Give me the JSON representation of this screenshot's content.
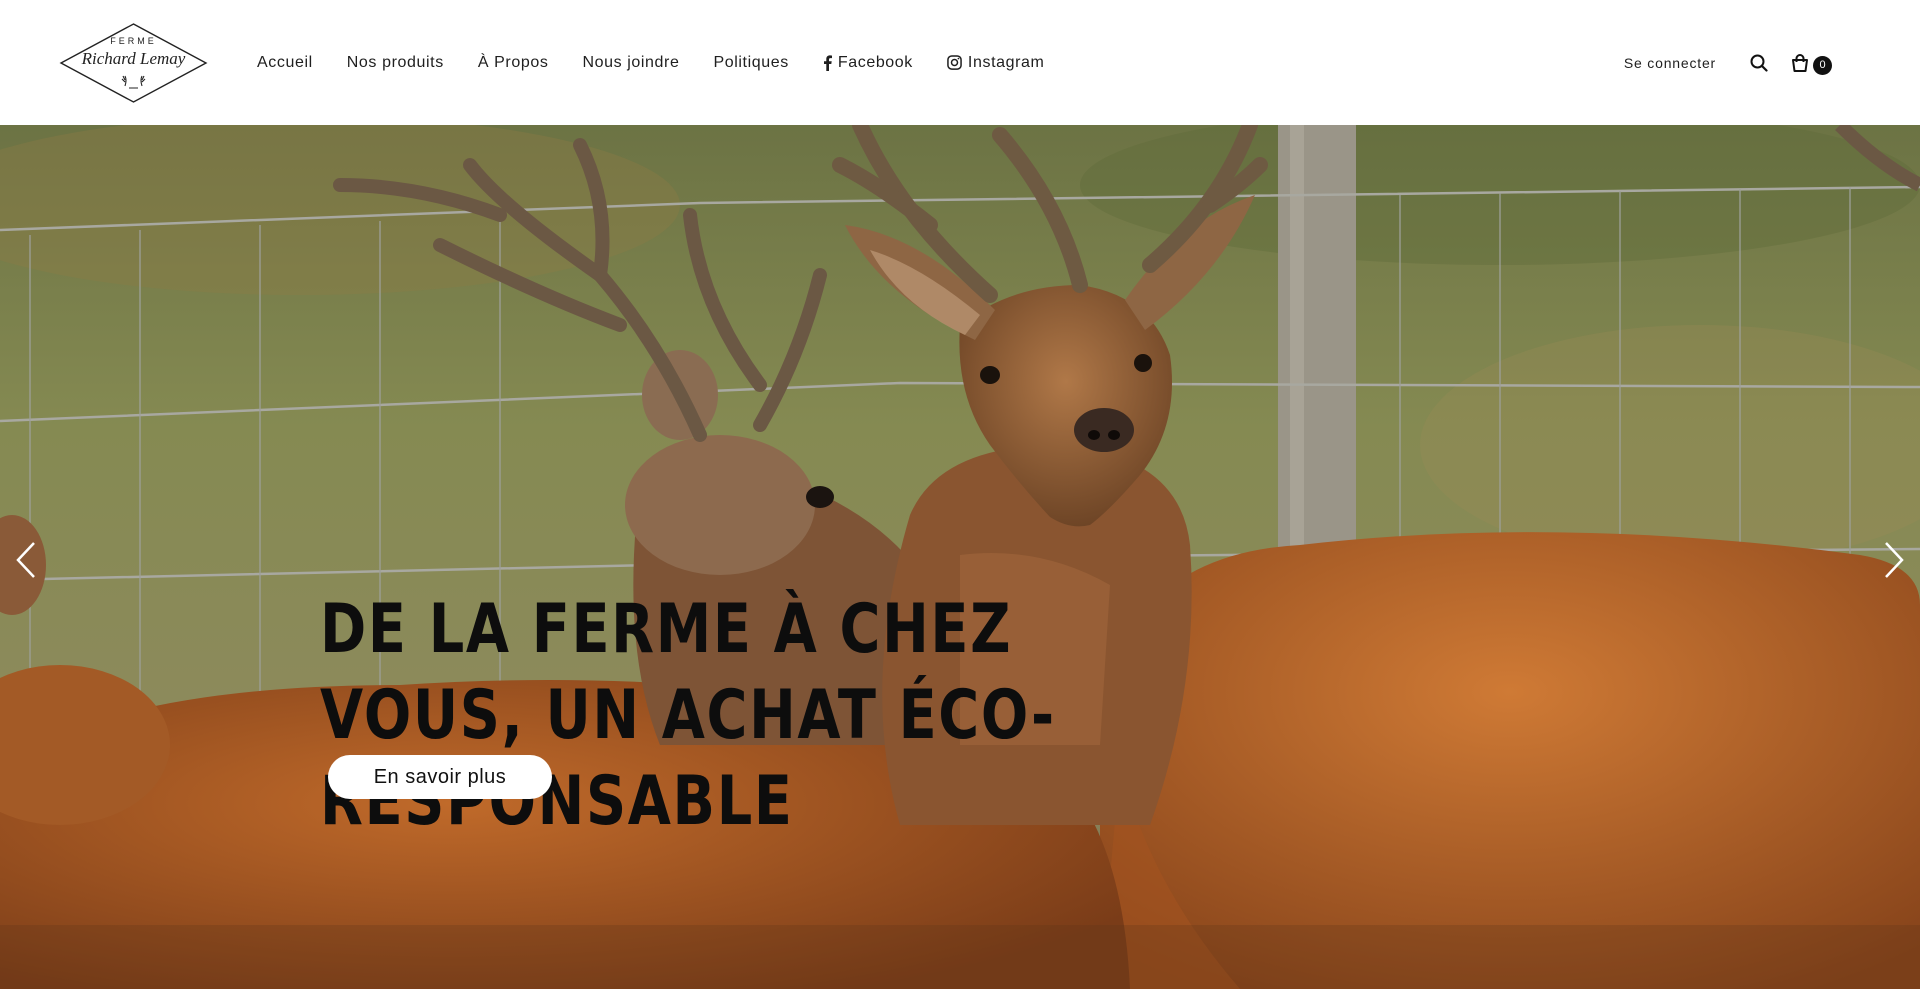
{
  "logo": {
    "top_text": "FERME",
    "main_text": "Richard Lemay"
  },
  "nav": {
    "items": [
      {
        "label": "Accueil",
        "icon": null
      },
      {
        "label": "Nos produits",
        "icon": null
      },
      {
        "label": "À Propos",
        "icon": null
      },
      {
        "label": "Nous joindre",
        "icon": null
      },
      {
        "label": "Politiques",
        "icon": null
      },
      {
        "label": "Facebook",
        "icon": "facebook-icon"
      },
      {
        "label": "Instagram",
        "icon": "instagram-icon"
      }
    ]
  },
  "header": {
    "login_label": "Se connecter",
    "search_icon": "search-icon",
    "cart_icon": "shopping-bag-icon",
    "cart_count": "0"
  },
  "hero": {
    "title": "DE LA FERME À CHEZ VOUS, UN ACHAT ÉCO-RESPONSABLE",
    "cta_label": "En savoir plus",
    "prev_icon": "chevron-left-icon",
    "next_icon": "chevron-right-icon"
  },
  "colors": {
    "header_bg": "#ffffff",
    "text": "#1f1f1f",
    "badge_bg": "#111111",
    "button_bg": "#ffffff"
  }
}
